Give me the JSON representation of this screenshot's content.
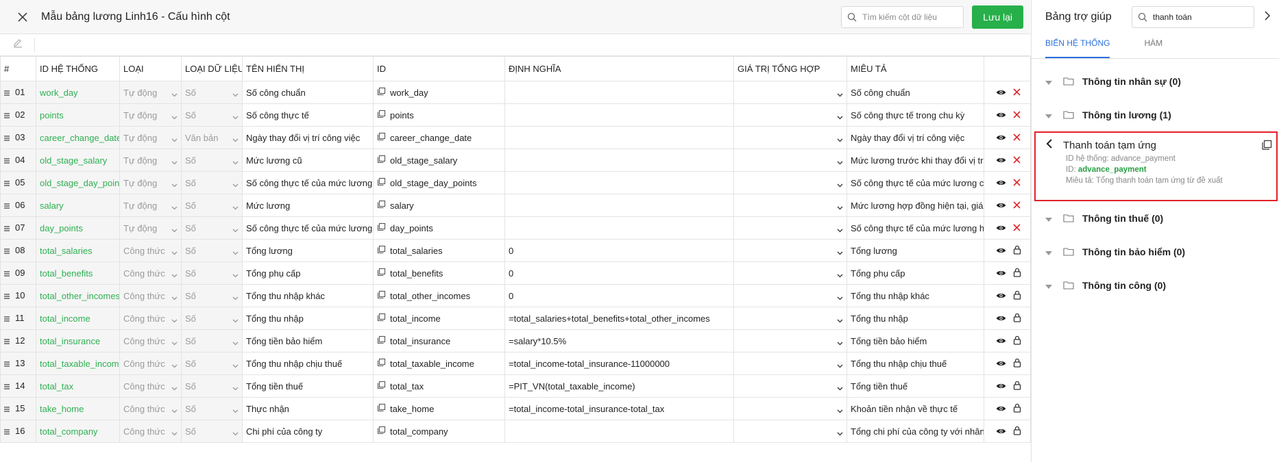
{
  "header": {
    "title": "Mẫu bảng lương Linh16 - Cấu hình cột",
    "search_placeholder": "Tìm kiếm cột dữ liệu",
    "save_label": "Lưu lại"
  },
  "table": {
    "columns": [
      "#",
      "ID HỆ THỐNG",
      "LOẠI",
      "LOẠI DỮ LIỆU",
      "TÊN HIỂN THỊ",
      "ID",
      "ĐỊNH NGHĨA",
      "GIÁ TRỊ TỔNG HỢP",
      "MIÊU TẢ"
    ],
    "rows": [
      {
        "num": "01",
        "sysid": "work_day",
        "type": "Tự động",
        "dtype": "Số",
        "name": "Số công chuẩn",
        "id": "work_day",
        "def": "",
        "desc": "Số công chuẩn",
        "locked": false
      },
      {
        "num": "02",
        "sysid": "points",
        "type": "Tự động",
        "dtype": "Số",
        "name": "Số công thực tế",
        "id": "points",
        "def": "",
        "desc": "Số công thực tế trong chu kỳ",
        "locked": false
      },
      {
        "num": "03",
        "sysid": "career_change_date_",
        "type": "Tự động",
        "dtype": "Văn bản",
        "name": "Ngày thay đổi vị trí công việc",
        "id": "career_change_date",
        "def": "",
        "desc": "Ngày thay đổi vị trí công việc",
        "locked": false
      },
      {
        "num": "04",
        "sysid": "old_stage_salary",
        "type": "Tự động",
        "dtype": "Số",
        "name": "Mức lương cũ",
        "id": "old_stage_salary",
        "def": "",
        "desc": "Mức lương trước khi thay đổi vị tr",
        "locked": false
      },
      {
        "num": "05",
        "sysid": "old_stage_day_point:",
        "type": "Tự động",
        "dtype": "Số",
        "name": "Số công thực tế của mức lương",
        "id": "old_stage_day_points",
        "def": "",
        "desc": "Số công thực tế của mức lương c",
        "locked": false
      },
      {
        "num": "06",
        "sysid": "salary",
        "type": "Tự động",
        "dtype": "Số",
        "name": "Mức lương",
        "id": "salary",
        "def": "",
        "desc": "Mức lương hợp đồng hiện tại, giá",
        "locked": false
      },
      {
        "num": "07",
        "sysid": "day_points",
        "type": "Tự động",
        "dtype": "Số",
        "name": "Số công thực tế của mức lương",
        "id": "day_points",
        "def": "",
        "desc": "Số công thực tế của mức lương h",
        "locked": false
      },
      {
        "num": "08",
        "sysid": "total_salaries",
        "type": "Công thức",
        "dtype": "Số",
        "name": "Tổng lương",
        "id": "total_salaries",
        "def": "0",
        "desc": "Tổng lương",
        "locked": true
      },
      {
        "num": "09",
        "sysid": "total_benefits",
        "type": "Công thức",
        "dtype": "Số",
        "name": "Tổng phụ cấp",
        "id": "total_benefits",
        "def": "0",
        "desc": "Tổng phụ cấp",
        "locked": true
      },
      {
        "num": "10",
        "sysid": "total_other_incomes",
        "type": "Công thức",
        "dtype": "Số",
        "name": "Tổng thu nhập khác",
        "id": "total_other_incomes",
        "def": "0",
        "desc": "Tổng thu nhập khác",
        "locked": true
      },
      {
        "num": "11",
        "sysid": "total_income",
        "type": "Công thức",
        "dtype": "Số",
        "name": "Tổng thu nhập",
        "id": "total_income",
        "def": "=total_salaries+total_benefits+total_other_incomes",
        "desc": "Tổng thu nhập",
        "locked": true
      },
      {
        "num": "12",
        "sysid": "total_insurance",
        "type": "Công thức",
        "dtype": "Số",
        "name": "Tổng tiền bảo hiểm",
        "id": "total_insurance",
        "def": "=salary*10.5%",
        "desc": "Tổng tiền bảo hiểm",
        "locked": true
      },
      {
        "num": "13",
        "sysid": "total_taxable_income",
        "type": "Công thức",
        "dtype": "Số",
        "name": "Tổng thu nhập chịu thuế",
        "id": "total_taxable_income",
        "def": "=total_income-total_insurance-11000000",
        "desc": "Tổng thu nhập chịu thuế",
        "locked": true
      },
      {
        "num": "14",
        "sysid": "total_tax",
        "type": "Công thức",
        "dtype": "Số",
        "name": "Tổng tiền thuế",
        "id": "total_tax",
        "def": "=PIT_VN(total_taxable_income)",
        "desc": "Tổng tiền thuế",
        "locked": true
      },
      {
        "num": "15",
        "sysid": "take_home",
        "type": "Công thức",
        "dtype": "Số",
        "name": "Thực nhận",
        "id": "take_home",
        "def": "=total_income-total_insurance-total_tax",
        "desc": "Khoản tiền nhận về thực tế",
        "locked": true
      },
      {
        "num": "16",
        "sysid": "total_company",
        "type": "Công thức",
        "dtype": "Số",
        "name": "Chi phí của công ty",
        "id": "total_company",
        "def": "",
        "desc": "Tổng chi phí của công ty với nhân",
        "locked": true
      }
    ]
  },
  "side": {
    "title": "Bảng trợ giúp",
    "search_value": "thanh toán",
    "tabs": [
      "BIẾN HỆ THỐNG",
      "HÀM"
    ],
    "groups_before": [
      {
        "label": "Thông tin nhân sự (0)"
      },
      {
        "label": "Thông tin lương (1)"
      }
    ],
    "detail": {
      "title": "Thanh toán tạm ứng",
      "sysid_line": "ID hệ thống: advance_payment",
      "id_prefix": "ID: ",
      "id_value": "advance_payment",
      "desc_line": "Miêu tả: Tổng thanh toán tạm ứng từ đề xuất"
    },
    "groups_after": [
      {
        "label": "Thông tin thuế (0)"
      },
      {
        "label": "Thông tin bảo hiểm (0)"
      },
      {
        "label": "Thông tin công (0)"
      }
    ]
  },
  "colors": {
    "accent_green": "#27b04a",
    "tab_blue": "#2a6fdb",
    "highlight_red": "#e32028",
    "delete_red": "#e0262d"
  }
}
